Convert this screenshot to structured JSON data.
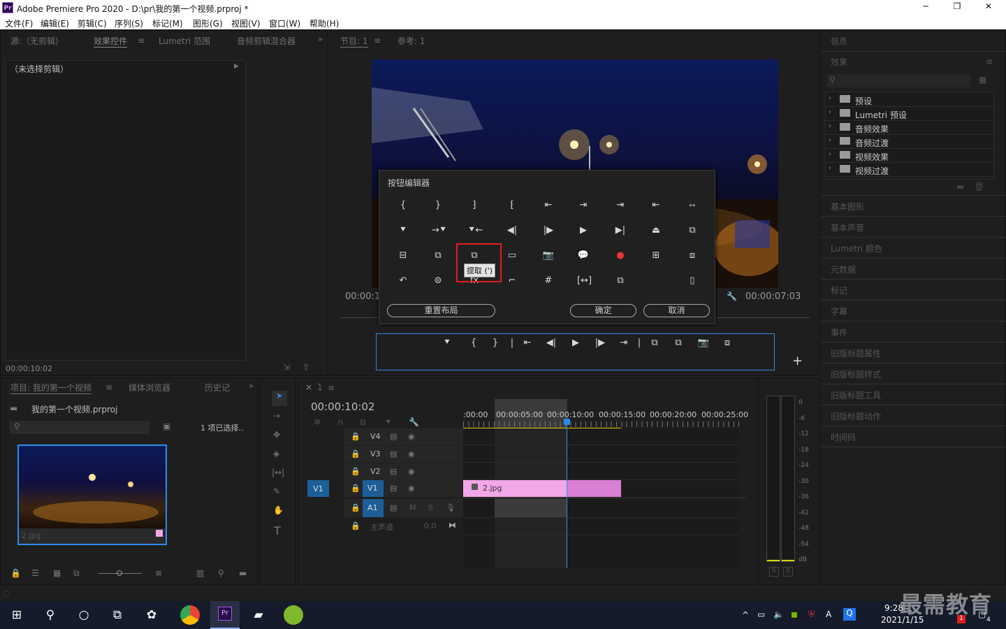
{
  "app": {
    "title": "Adobe Premiere Pro 2020 - D:\\pr\\我的第一个视频.prproj *",
    "logo": "Pr"
  },
  "window_controls": {
    "minimize": "─",
    "restore": "❐",
    "close": "✕"
  },
  "menu": [
    "文件(F)",
    "编辑(E)",
    "剪辑(C)",
    "序列(S)",
    "标记(M)",
    "图形(G)",
    "视图(V)",
    "窗口(W)",
    "帮助(H)"
  ],
  "source_panel": {
    "tabs": [
      "源:（无剪辑）",
      "效果控件",
      "Lumetri 范围",
      "音频剪辑混合器"
    ],
    "no_clip": "（未选择剪辑）",
    "timecode": "00:00:10:02"
  },
  "program_panel": {
    "tabs": [
      "节目: 1",
      "参考: 1"
    ],
    "timecode_left": "00:00:1",
    "timecode_right": "00:00:07:03"
  },
  "button_editor": {
    "title": "按钮编辑器",
    "tooltip": "提取 (')",
    "reset_label": "重置布局",
    "ok_label": "确定",
    "cancel_label": "取消",
    "rows": [
      [
        "{",
        "}",
        "⁆",
        "⁅",
        "⇤",
        "⇥",
        "⇥",
        "⇤",
        "⇿"
      ],
      [
        "⯆",
        "→⯆",
        "⯆←",
        "◀|",
        "|▶",
        "▶",
        "▶|",
        "⏏",
        "⧉"
      ],
      [
        "⊟",
        "⧉",
        "⧉",
        "▭",
        "📷",
        "💬",
        "●",
        "⊞",
        "⧈"
      ],
      [
        "↶",
        "⊜",
        "fx",
        "⌐",
        "#",
        "[↔]",
        "⧉",
        "",
        "▯"
      ]
    ]
  },
  "transport": [
    "⯆",
    "{",
    "}",
    "|",
    "⇤",
    "◀|",
    "▶",
    "|▶",
    "⇥",
    "|",
    "⧉",
    "⧉",
    "📷",
    "⧈"
  ],
  "add_button": "+",
  "project_panel": {
    "tabs": [
      "项目: 我的第一个视频",
      "媒体浏览器",
      "历史记"
    ],
    "file": "我的第一个视频.prproj",
    "count": "1 项已选择..",
    "thumb_label": "2.jpg"
  },
  "timeline": {
    "close": "×",
    "seq": "1",
    "timecode": "00:00:10:02",
    "ruler": [
      ":00:00",
      "00:00:05:00",
      "00:00:10:00",
      "00:00:15:00",
      "00:00:20:00",
      "00:00:25:00"
    ],
    "tracks": [
      "V4",
      "V3",
      "V2",
      "V1",
      "A1"
    ],
    "src_v1": "V1",
    "master_label": "主声道",
    "master_value": "0.0",
    "clip_label": "2.jpg",
    "audio_labels": [
      "M",
      "S"
    ]
  },
  "meter_scale": [
    "0",
    "-6",
    "-12",
    "-18",
    "-24",
    "-30",
    "-36",
    "-42",
    "-48",
    "-54",
    "dB"
  ],
  "meter_solo": [
    "S",
    "S"
  ],
  "right_panel": {
    "info": "信息",
    "effects": "效果",
    "folders": [
      "预设",
      "Lumetri 预设",
      "音频效果",
      "音频过渡",
      "视频效果",
      "视频过渡"
    ],
    "items": [
      "基本图形",
      "基本声音",
      "Lumetri 颜色",
      "元数据",
      "标记",
      "字幕",
      "事件",
      "旧版标题属性",
      "旧版标题样式",
      "旧版标题工具",
      "旧版标题动作",
      "时间码"
    ]
  },
  "taskbar": {
    "time": "9:28",
    "date": "2021/1/15",
    "watermark": "最需教育",
    "ime": "A",
    "notif": "4",
    "badge": "1"
  },
  "colors": {
    "accent": "#2d8ceb",
    "clip_pink": "#f2a7e8",
    "clip_pink_dark": "#d97fd3",
    "highlight_red": "#e11e1e",
    "yellow": "#d6d600"
  }
}
